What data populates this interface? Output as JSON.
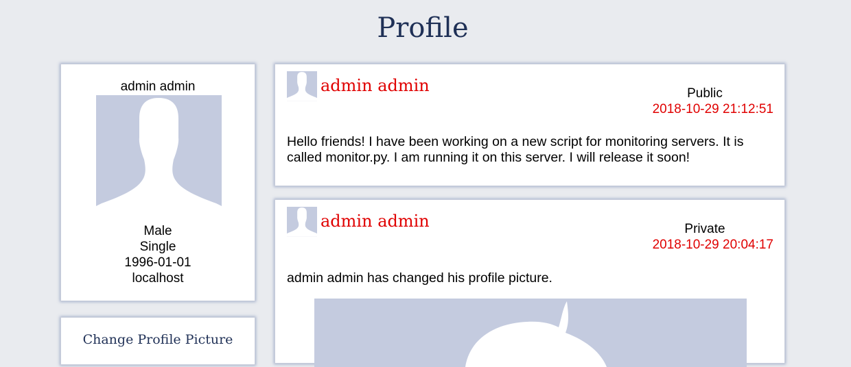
{
  "page": {
    "title": "Profile"
  },
  "sidebar": {
    "name": "admin admin",
    "gender": "Male",
    "relationship": "Single",
    "birthdate": "1996-01-01",
    "location": "localhost",
    "change_picture_label": "Change Profile Picture"
  },
  "posts": [
    {
      "author": "admin admin",
      "visibility": "Public",
      "timestamp": "2018-10-29 21:12:51",
      "body": "Hello friends! I have been working on a new script for monitoring servers. It is called monitor.py. I am running it on this server. I will release it soon!"
    },
    {
      "author": "admin admin",
      "visibility": "Private",
      "timestamp": "2018-10-29 20:04:17",
      "body": "admin admin has changed his profile picture."
    }
  ],
  "colors": {
    "background": "#e9ebef",
    "title": "#1f3056",
    "author": "#e00000",
    "timestamp": "#e00000",
    "avatar_bg": "#c4cbdf"
  },
  "icons": {
    "avatar": "default-avatar-silhouette-icon"
  }
}
